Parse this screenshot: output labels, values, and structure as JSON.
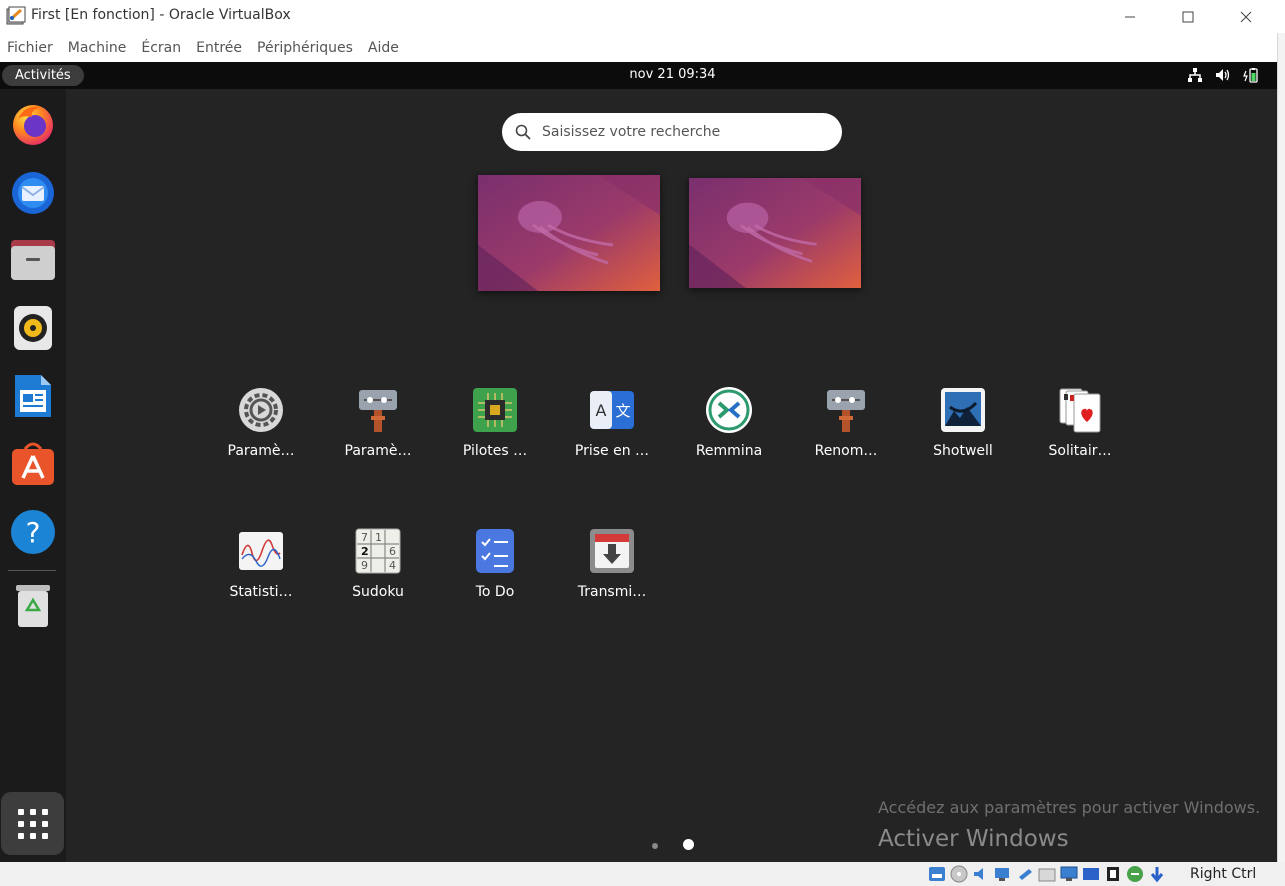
{
  "window": {
    "title": "First [En fonction] - Oracle VirtualBox",
    "controls": [
      "minimize",
      "maximize",
      "close"
    ]
  },
  "menubar": {
    "items": [
      "Fichier",
      "Machine",
      "Écran",
      "Entrée",
      "Périphériques",
      "Aide"
    ]
  },
  "topbar": {
    "activities": "Activités",
    "clock": "nov 21  09:34",
    "tray_icons": [
      "network-icon",
      "volume-icon",
      "battery-icon"
    ]
  },
  "dock": {
    "items": [
      {
        "name": "firefox",
        "icon": "firefox-icon"
      },
      {
        "name": "thunderbird",
        "icon": "thunderbird-icon"
      },
      {
        "name": "files",
        "icon": "folder-icon"
      },
      {
        "name": "rhythmbox",
        "icon": "speaker-icon"
      },
      {
        "name": "libreoffice-writer",
        "icon": "document-icon"
      },
      {
        "name": "ubuntu-software",
        "icon": "software-store-icon"
      },
      {
        "name": "help",
        "icon": "help-icon"
      },
      {
        "name": "trash",
        "icon": "trash-icon"
      }
    ],
    "show_apps_icon": "app-grid-icon"
  },
  "search": {
    "placeholder": "Saisissez votre recherche",
    "value": ""
  },
  "apps": {
    "row1": [
      {
        "label": "Paramè…",
        "icon": "gear-icon"
      },
      {
        "label": "Paramè…",
        "icon": "tweaks-icon"
      },
      {
        "label": "Pilotes …",
        "icon": "chip-icon"
      },
      {
        "label": "Prise en …",
        "icon": "translate-icon"
      },
      {
        "label": "Remmina",
        "icon": "remote-desktop-icon"
      },
      {
        "label": "Renom…",
        "icon": "rename-icon"
      },
      {
        "label": "Shotwell",
        "icon": "photo-icon"
      },
      {
        "label": "Solitair…",
        "icon": "cards-icon"
      }
    ],
    "row2": [
      {
        "label": "Statisti…",
        "icon": "stats-icon"
      },
      {
        "label": "Sudoku",
        "icon": "sudoku-icon"
      },
      {
        "label": "To Do",
        "icon": "checklist-icon"
      },
      {
        "label": "Transmi…",
        "icon": "download-icon"
      }
    ]
  },
  "sudoku_digits": [
    "7",
    "1",
    "2",
    "6",
    "9",
    "4"
  ],
  "translate_letters": [
    "A",
    "文"
  ],
  "pagination": {
    "pages": 2,
    "current": 2
  },
  "watermark": {
    "title": "Activer Windows",
    "subtitle": "Accédez aux paramètres pour activer Windows."
  },
  "statusbar": {
    "host_key": "Right Ctrl"
  },
  "colors": {
    "guest_bg": "#242424",
    "dock_bg": "#1b1b1b",
    "topbar_bg": "#0c0c0c",
    "wallpaper_a": "#7a2f6e",
    "wallpaper_b": "#e0603e"
  }
}
